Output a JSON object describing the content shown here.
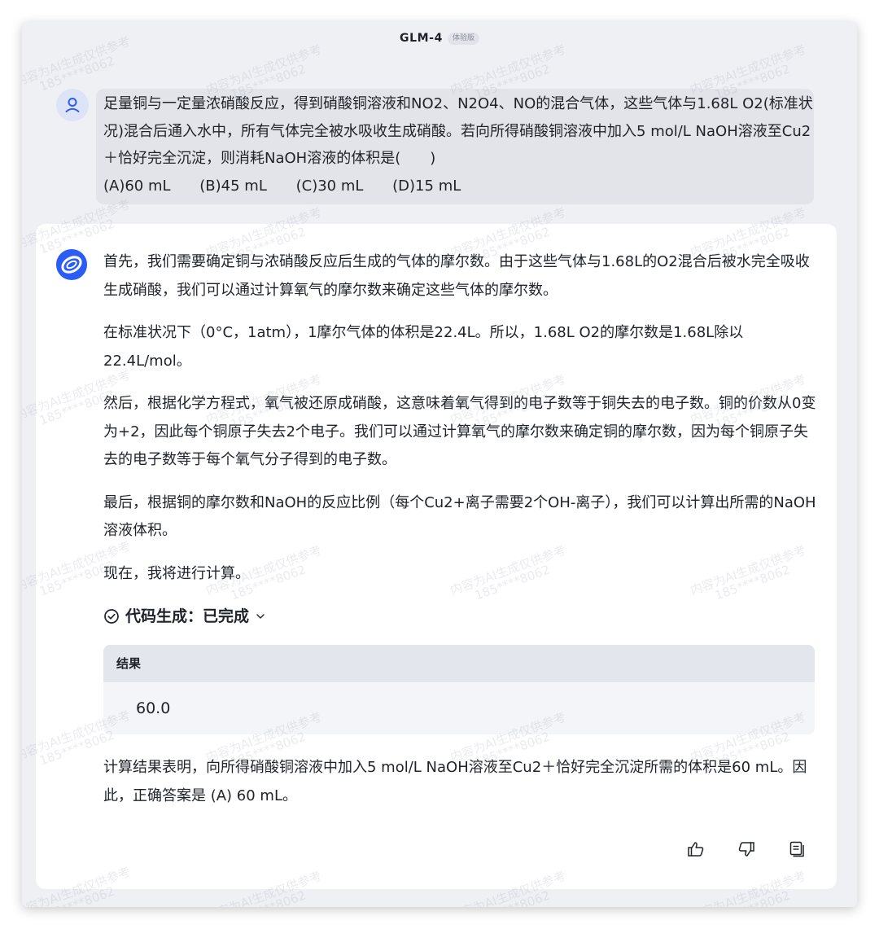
{
  "header": {
    "model_name": "GLM-4",
    "badge": "体验版"
  },
  "watermark": {
    "line1": "内容为AI生成仅供参考",
    "line2": "185****8062"
  },
  "user_message": {
    "text": "足量铜与一定量浓硝酸反应，得到硝酸铜溶液和NO2、N2O4、NO的混合气体，这些气体与1.68L O2(标准状况)混合后通入水中，所有气体完全被水吸收生成硝酸。若向所得硝酸铜溶液中加入5 mol/L NaOH溶液至Cu2＋恰好完全沉淀，则消耗NaOH溶液的体积是(　　)",
    "options": [
      "(A)60 mL",
      "(B)45 mL",
      "(C)30 mL",
      "(D)15 mL"
    ]
  },
  "answer": {
    "paragraphs": [
      "首先，我们需要确定铜与浓硝酸反应后生成的气体的摩尔数。由于这些气体与1.68L的O2混合后被水完全吸收生成硝酸，我们可以通过计算氧气的摩尔数来确定这些气体的摩尔数。",
      "在标准状况下（0°C，1atm），1摩尔气体的体积是22.4L。所以，1.68L O2的摩尔数是1.68L除以22.4L/mol。",
      "然后，根据化学方程式，氧气被还原成硝酸，这意味着氧气得到的电子数等于铜失去的电子数。铜的价数从0变为+2，因此每个铜原子失去2个电子。我们可以通过计算氧气的摩尔数来确定铜的摩尔数，因为每个铜原子失去的电子数等于每个氧气分子得到的电子数。",
      "最后，根据铜的摩尔数和NaOH的反应比例（每个Cu2+离子需要2个OH-离子），我们可以计算出所需的NaOH溶液体积。",
      "现在，我将进行计算。"
    ],
    "code_status": "代码生成：已完成",
    "result_label": "结果",
    "result_value": "60.0",
    "conclusion": "计算结果表明，向所得硝酸铜溶液中加入5 mol/L NaOH溶液至Cu2＋恰好完全沉淀所需的体积是60 mL。因此，正确答案是 (A) 60 mL。"
  },
  "actions": {
    "like_icon": "thumbs-up-icon",
    "dislike_icon": "thumbs-down-icon",
    "copy_icon": "copy-icon"
  },
  "colors": {
    "window_bg": "#eff0f4",
    "user_bubble": "#e2e4ea",
    "accent_blue": "#2b5cf5",
    "user_avatar_bg": "#dde4f8"
  }
}
